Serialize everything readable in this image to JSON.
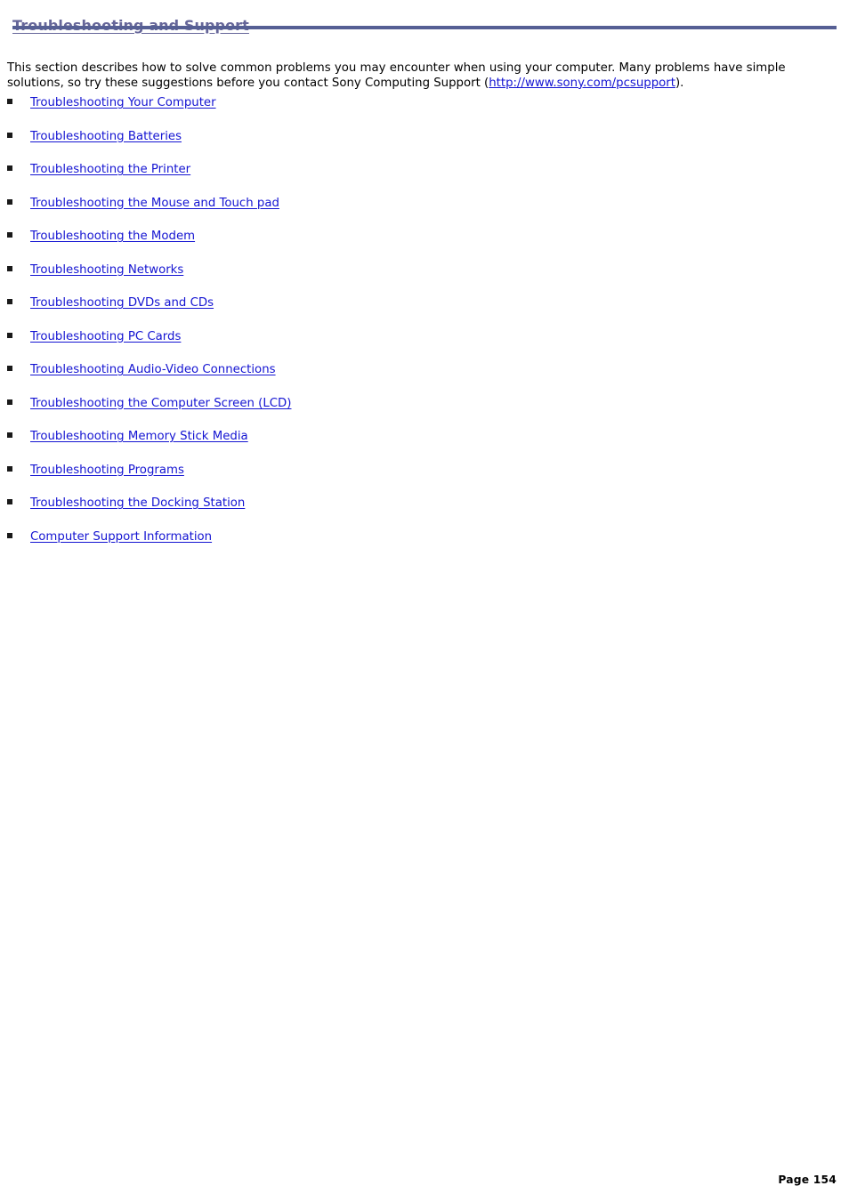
{
  "document": {
    "heading": "Troubleshooting and Support",
    "accent_color": "#666699",
    "rule_color": "#565f94",
    "link_color": "#1414d2",
    "intro": {
      "text_before_link": "This section describes how to solve common problems you may encounter when using your computer. Many problems have simple solutions, so try these suggestions before you contact Sony Computing Support (",
      "link_text": "http://www.sony.com/pcsupport",
      "text_after_link": ")."
    },
    "toc": [
      {
        "label": "Troubleshooting Your Computer"
      },
      {
        "label": "Troubleshooting Batteries"
      },
      {
        "label": "Troubleshooting the Printer"
      },
      {
        "label": "Troubleshooting the Mouse and Touch pad"
      },
      {
        "label": "Troubleshooting the Modem"
      },
      {
        "label": "Troubleshooting Networks"
      },
      {
        "label": "Troubleshooting DVDs and CDs"
      },
      {
        "label": "Troubleshooting PC Cards"
      },
      {
        "label": "Troubleshooting Audio-Video Connections"
      },
      {
        "label": "Troubleshooting the Computer Screen (LCD)"
      },
      {
        "label": "Troubleshooting Memory Stick Media"
      },
      {
        "label": "Troubleshooting Programs"
      },
      {
        "label": "Troubleshooting the Docking Station"
      },
      {
        "label": "Computer Support Information"
      }
    ],
    "footer": {
      "page_label": "Page 154"
    }
  }
}
